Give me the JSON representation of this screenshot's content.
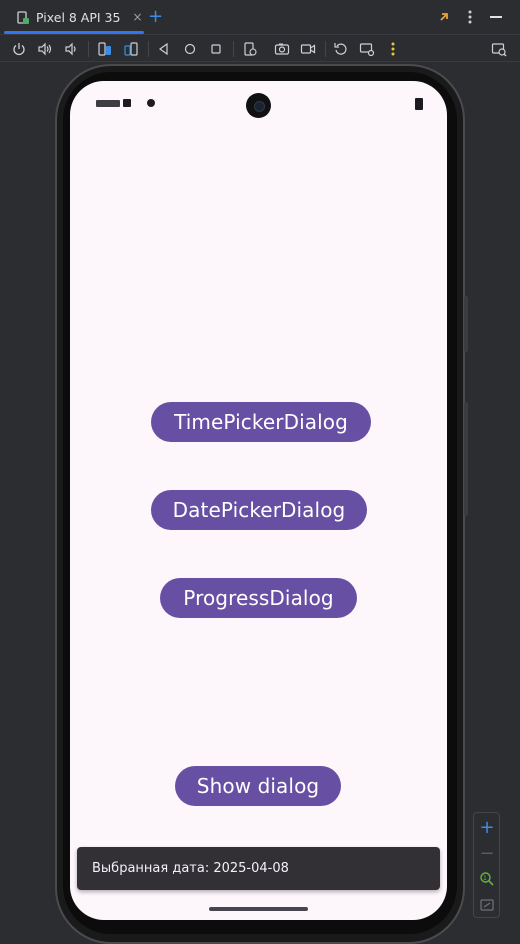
{
  "ide": {
    "tab": {
      "label": "Pixel 8 API 35",
      "close": "×"
    },
    "add_tab": "+",
    "toolbar_icons": [
      "power-icon",
      "volume-up-icon",
      "volume-down-icon",
      "rotate-left-icon",
      "rotate-right-icon",
      "back-icon",
      "home-icon",
      "overview-icon",
      "fold-icon",
      "camera-icon",
      "video-icon",
      "reset-icon",
      "device-settings-icon",
      "more-icon",
      "device-explorer-icon"
    ],
    "colors": {
      "accent": "#3574f0",
      "add": "#3d8de8",
      "notify": "#e8a23d"
    }
  },
  "device": {
    "buttons": {
      "time_picker": "TimePickerDialog",
      "date_picker": "DatePickerDialog",
      "progress": "ProgressDialog",
      "show_dialog": "Show dialog"
    },
    "snackbar": {
      "text": "Выбранная дата: 2025-04-08"
    },
    "colors": {
      "button": "#6750a4",
      "background": "#fdf7fb",
      "snackbar": "#322f35"
    }
  },
  "zoom": {
    "zoom_in": "+",
    "zoom_out": "−"
  }
}
